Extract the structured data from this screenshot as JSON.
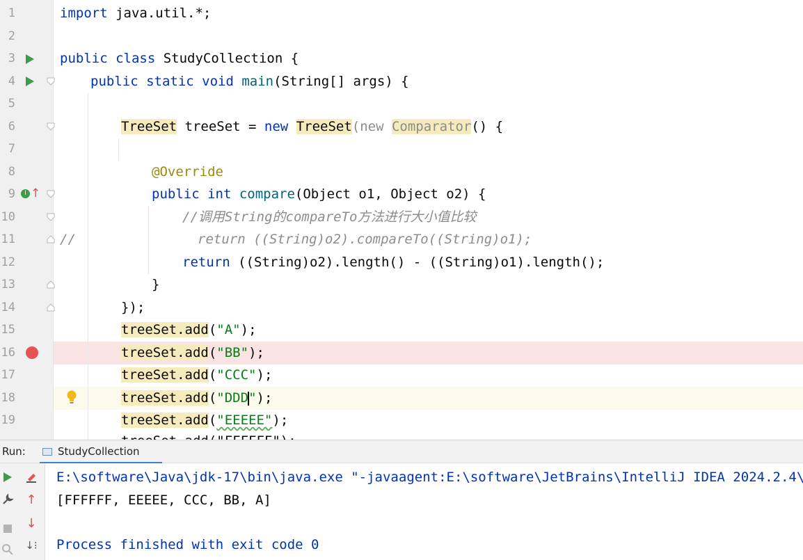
{
  "editor": {
    "line_numbers": [
      "1",
      "2",
      "3",
      "4",
      "5",
      "6",
      "7",
      "8",
      "9",
      "10",
      "11",
      "12",
      "13",
      "14",
      "15",
      "16",
      "17",
      "18",
      "19"
    ],
    "lines": {
      "l1": {
        "a": "import",
        "b": " java.util.*;"
      },
      "l3": {
        "a": "public class",
        "b": " StudyCollection {"
      },
      "l4": {
        "a": "public static void ",
        "b": "main",
        "c": "(String[] args) {"
      },
      "l6": {
        "a": "TreeSet",
        "b": " treeSet = ",
        "c": "new ",
        "d": "TreeSet",
        "e": "(new ",
        "f": "Comparator",
        "g": "() {"
      },
      "l8": {
        "a": "@Override"
      },
      "l9": {
        "a": "public int ",
        "b": "compare",
        "c": "(Object o1, Object o2) {"
      },
      "l10": {
        "a": "//调用String的compareTo方法进行大小值比较"
      },
      "l11": {
        "a": "//",
        "b": "return ((String)o2).compareTo((String)o1);"
      },
      "l12": {
        "a": "return ",
        "b": "((String)o2).length() - ((String)o1).length();"
      },
      "l13": {
        "a": "}"
      },
      "l14": {
        "a": "});"
      },
      "l15": {
        "a": "treeSet.add",
        "b": "(",
        "c": "\"A\"",
        "d": ");"
      },
      "l16": {
        "a": "treeSet.add",
        "b": "(",
        "c": "\"BB\"",
        "d": ");"
      },
      "l17": {
        "a": "treeSet.add",
        "b": "(",
        "c": "\"CCC\"",
        "d": ");"
      },
      "l18": {
        "a": "treeSet.add",
        "b": "(",
        "c": "\"DDD",
        "c2": "\"",
        "d": ");"
      },
      "l19": {
        "a": "treeSet.add",
        "b": "(",
        "c": "\"EEEEE\"",
        "d": ");"
      },
      "l20": {
        "a": "treeSet.add(\"FFFFFF\");"
      }
    }
  },
  "run_panel": {
    "label": "Run:",
    "tab_label": "StudyCollection",
    "console": {
      "command": "E:\\software\\Java\\jdk-17\\bin\\java.exe \"-javaagent:E:\\software\\JetBrains\\IntelliJ IDEA 2024.2.4\\lib\\",
      "output": "[FFFFFF, EEEEE, CCC, BB, A]",
      "exit": "Process finished with exit code 0"
    }
  },
  "colors": {
    "keyword": "#0033b3",
    "string": "#067d17",
    "annotation": "#9e880d",
    "comment": "#8c8c8c",
    "breakpoint": "#e55353",
    "run_icon": "#3e9c46"
  }
}
